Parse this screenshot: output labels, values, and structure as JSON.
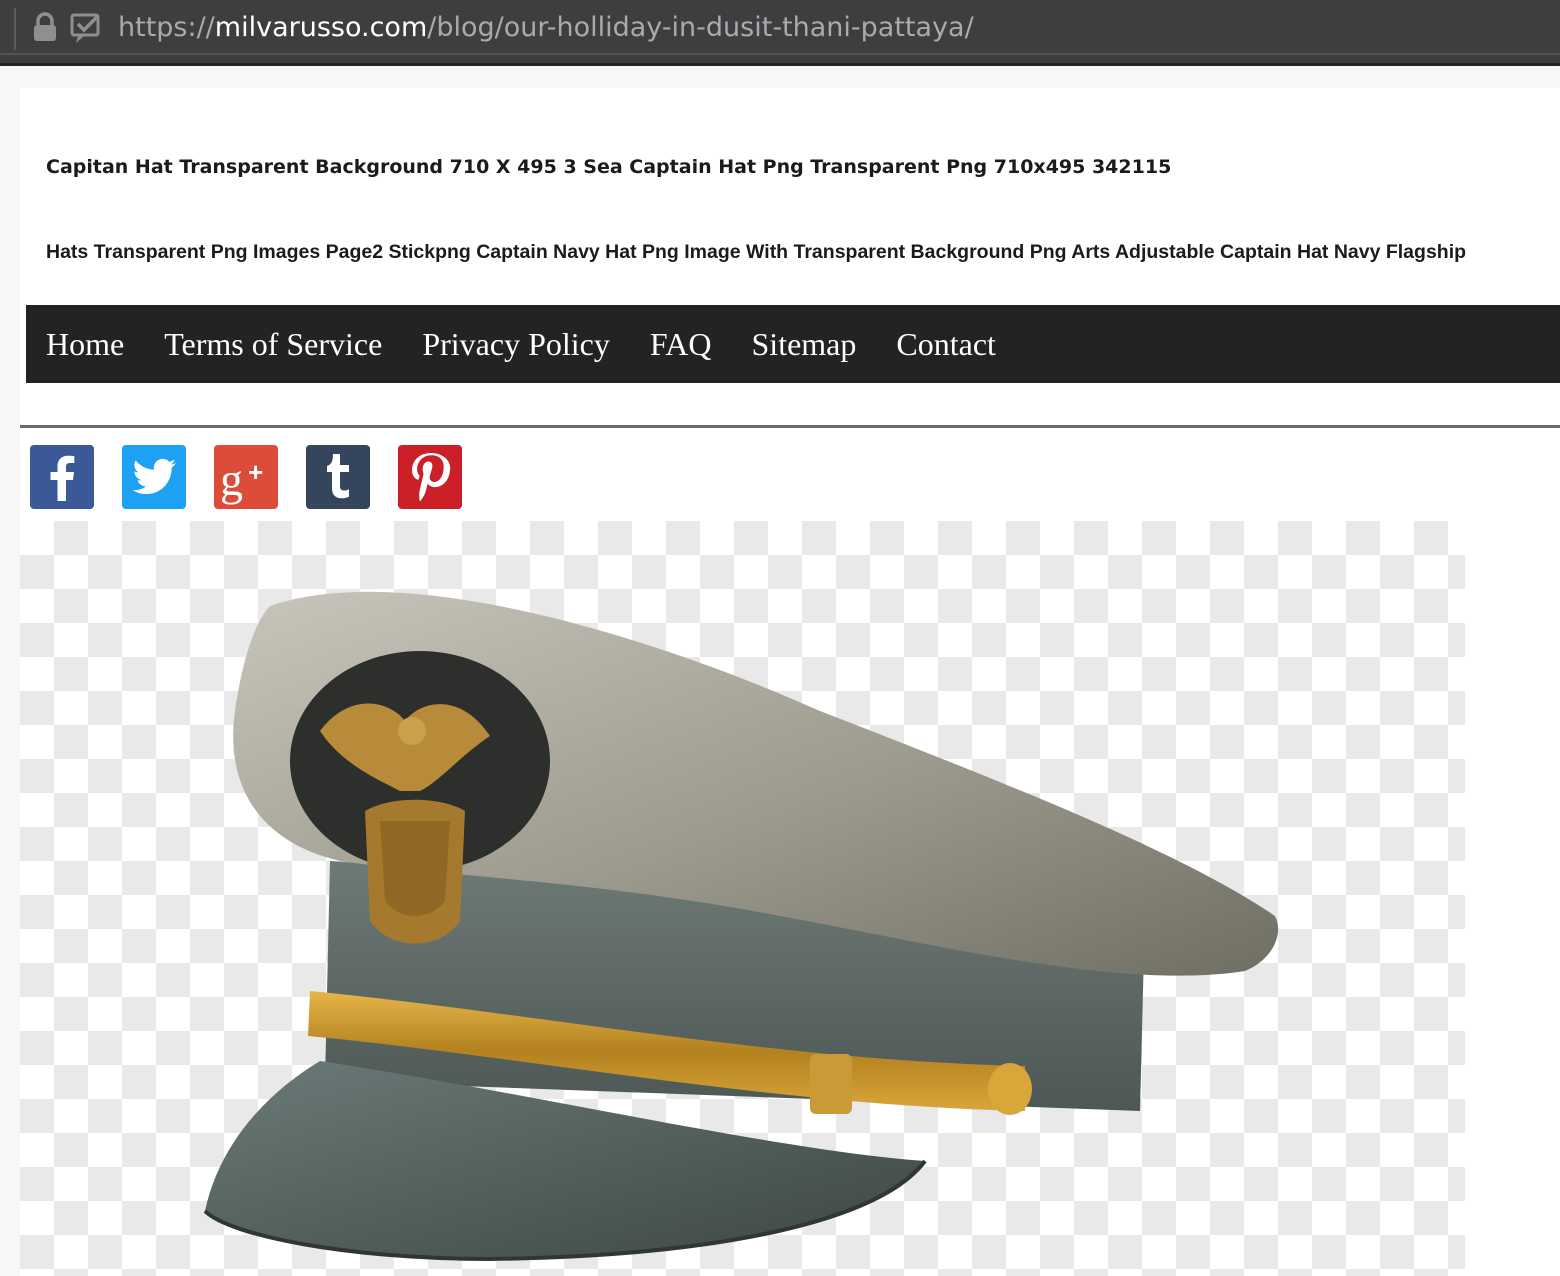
{
  "browser": {
    "url_prefix": "https://",
    "url_host": "milvarusso.com",
    "url_path": "/blog/our-holliday-in-dusit-thani-pattaya/"
  },
  "page": {
    "headline1": "Capitan Hat Transparent Background 710 X 495 3 Sea Captain Hat Png Transparent Png 710x495 342115",
    "headline2": "Hats Transparent Png Images Page2 Stickpng Captain Navy Hat Png Image With Transparent Background Png Arts Adjustable Captain Hat Navy Flagship"
  },
  "nav": {
    "items": [
      {
        "label": "Home"
      },
      {
        "label": "Terms of Service"
      },
      {
        "label": "Privacy Policy"
      },
      {
        "label": "FAQ"
      },
      {
        "label": "Sitemap"
      },
      {
        "label": "Contact"
      }
    ]
  },
  "social": [
    {
      "icon": "facebook-icon",
      "color": "#3b5998"
    },
    {
      "icon": "twitter-icon",
      "color": "#1da1f2"
    },
    {
      "icon": "google-plus-icon",
      "color": "#dd4b39"
    },
    {
      "icon": "tumblr-icon",
      "color": "#35465c"
    },
    {
      "icon": "pinterest-icon",
      "color": "#cb2027"
    }
  ],
  "colors": {
    "url_bar": "#3d3e40",
    "nav_bg": "#232323",
    "nav_text": "#ffffff"
  }
}
